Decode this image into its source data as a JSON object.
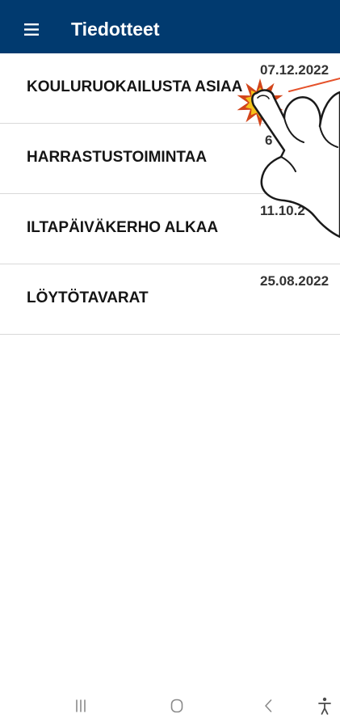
{
  "app_bar": {
    "menu_icon": "hamburger-menu-icon",
    "title": "Tiedotteet"
  },
  "announcements": [
    {
      "title": "KOULURUOKAILUSTA ASIAA",
      "date": "07.12.2022"
    },
    {
      "title": "HARRASTUSTOIMINTAA",
      "date": "6"
    },
    {
      "title": "ILTAPÄIVÄKERHO ALKAA",
      "date": "11.10.2"
    },
    {
      "title": "LÖYTÖTAVARAT",
      "date": "25.08.2022"
    }
  ],
  "tutorial_overlay": {
    "icons": [
      "starburst-icon",
      "pointing-hand-icon"
    ]
  },
  "system_nav": {
    "icons": [
      "recent-apps-icon",
      "home-icon",
      "back-icon",
      "accessibility-icon"
    ]
  },
  "theme": {
    "app_bar_bg": "#013a6f",
    "app_bar_text": "#ffffff",
    "title_text": "#151515",
    "date_text": "#333333",
    "separator": "#d9d9d9",
    "highlight_rays": "#d2451b",
    "highlight_core": "#f4c21a",
    "pointer_line": "#e5522b",
    "hand_outline": "#1a1a1a",
    "nav_icon": "#8a8a8a",
    "accessibility_icon": "#4a4a4a"
  }
}
